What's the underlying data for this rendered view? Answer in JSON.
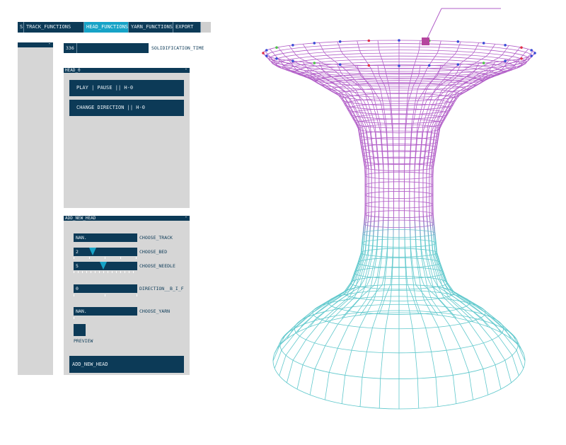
{
  "tabs": [
    "S",
    "TRACK_FUNCTIONS",
    "HEAD_FUNCTIONS",
    "YARN_FUNCTIONS",
    "EXPORT"
  ],
  "active_tab": "HEAD_FUNCTIONS",
  "left_panel": {
    "collapse": "-"
  },
  "solidification": {
    "value": "336",
    "label": "SOLIDIFICATION_TIME"
  },
  "head_panel": {
    "title": "HEAD_0",
    "collapse": "-",
    "play_pause": "PLAY | PAUSE  || H-0",
    "change_direction": "CHANGE DIRECTION  || H-0"
  },
  "add_panel": {
    "title": "ADD_NEW_HEAD",
    "collapse": "-",
    "track": {
      "value": "NAN.",
      "label": "CHOOSE_TRACK"
    },
    "bed": {
      "value": "2",
      "label": "CHOOSE_BED",
      "level": 0.3
    },
    "needle": {
      "value": "5",
      "label": "CHOOSE_NEEDLE",
      "level": 0.47
    },
    "direction": {
      "value": "0",
      "label": "DIRECTION__B_I_F"
    },
    "yarn": {
      "value": "NAN.",
      "label": "CHOOSE_YARN"
    },
    "preview_label": "PREVIEW",
    "add_button": "ADD_NEW_HEAD"
  },
  "colors": {
    "navy": "#0c3a57",
    "accent": "#16a3c7",
    "mesh_top": "#b25fc8",
    "mesh_bottom": "#5fc8cc"
  }
}
